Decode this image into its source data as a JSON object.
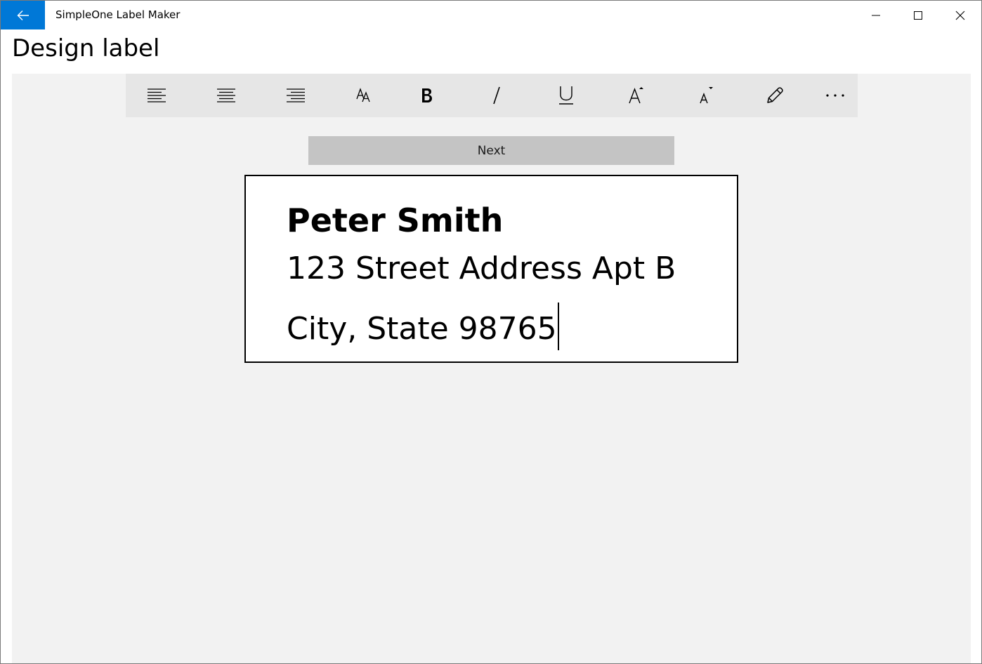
{
  "app": {
    "title": "SimpleOne Label Maker",
    "accent_color": "#0078d7"
  },
  "titlebar": {
    "back_icon": "back-arrow-icon",
    "minimize_icon": "minimize-icon",
    "maximize_icon": "maximize-icon",
    "close_icon": "close-icon"
  },
  "page": {
    "title": "Design label"
  },
  "toolbar": {
    "items": [
      {
        "name": "align-left",
        "icon": "align-left-icon"
      },
      {
        "name": "align-center",
        "icon": "align-center-icon"
      },
      {
        "name": "align-right",
        "icon": "align-right-icon"
      },
      {
        "name": "font",
        "icon": "font-size-icon"
      },
      {
        "name": "bold",
        "icon": "bold-icon"
      },
      {
        "name": "italic",
        "icon": "italic-icon"
      },
      {
        "name": "underline",
        "icon": "underline-icon"
      },
      {
        "name": "increase-font",
        "icon": "increase-font-icon"
      },
      {
        "name": "decrease-font",
        "icon": "decrease-font-icon"
      },
      {
        "name": "edit",
        "icon": "pencil-icon"
      },
      {
        "name": "more",
        "icon": "more-icon"
      }
    ]
  },
  "next_button": {
    "label": "Next"
  },
  "label": {
    "lines": [
      "Peter Smith",
      "123 Street Address Apt B",
      "City, State 98765"
    ]
  }
}
